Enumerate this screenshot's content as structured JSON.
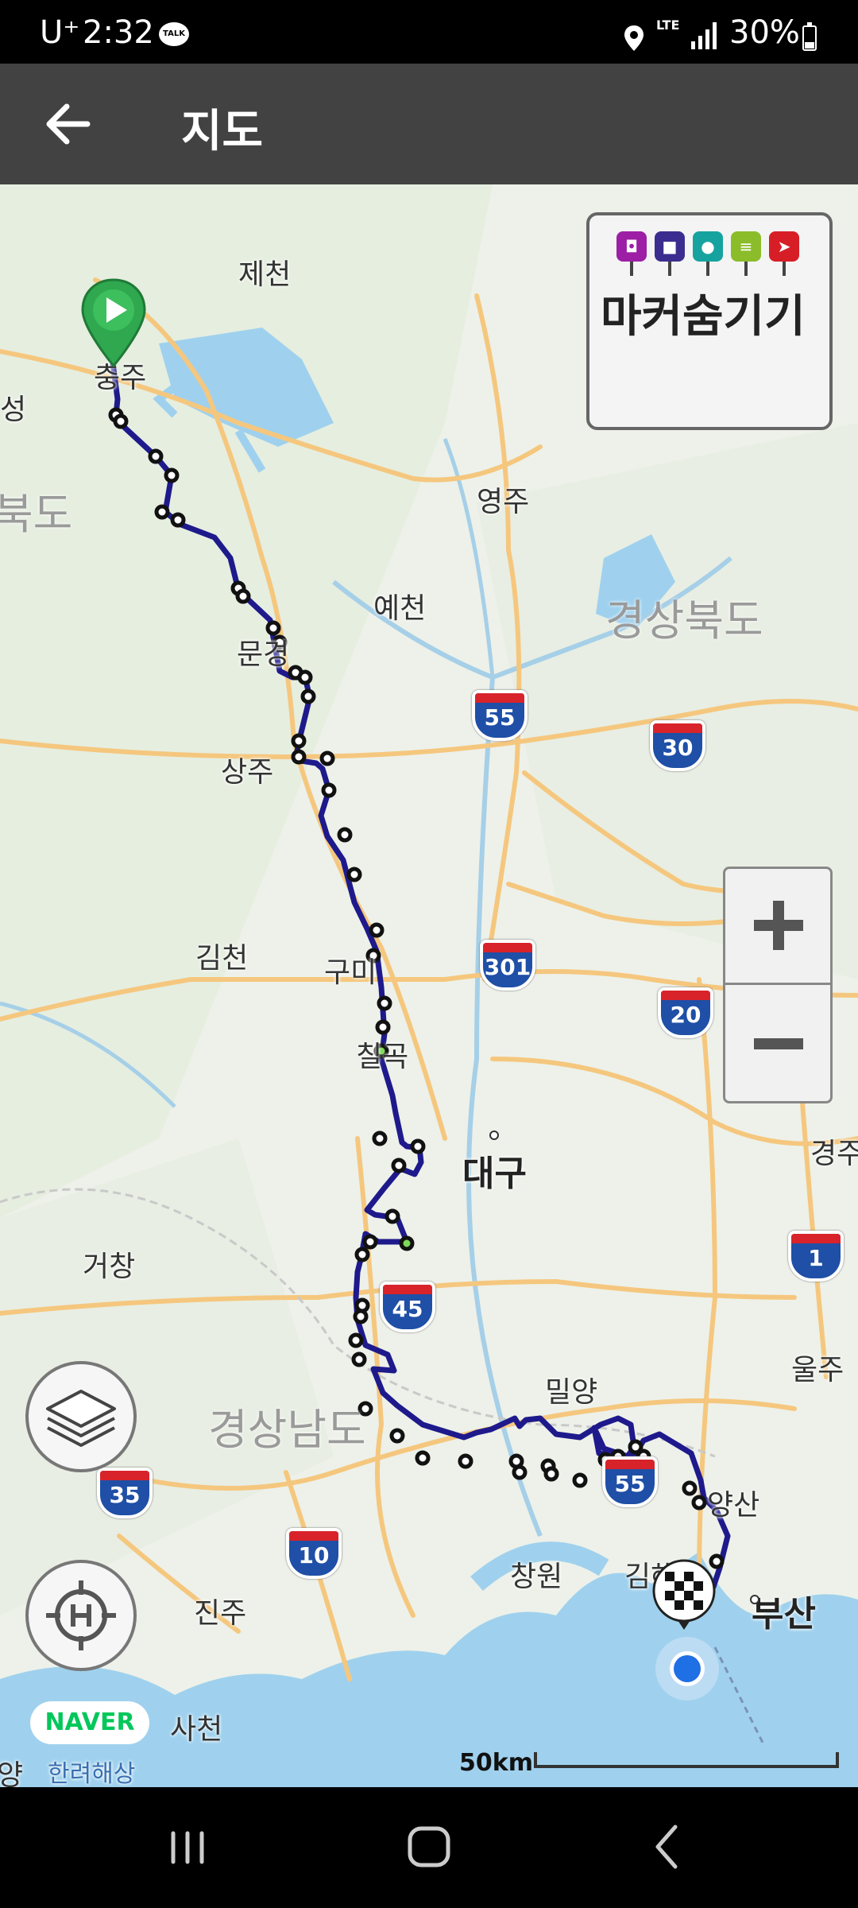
{
  "status_bar": {
    "carrier": "U⁺",
    "time": "2:32",
    "talk_badge": "TALK",
    "network": "LTE",
    "battery": "30%"
  },
  "app_bar": {
    "title": "지도"
  },
  "marker_panel": {
    "label": "마커숨기기",
    "marker_types": [
      {
        "icon": "camera-icon",
        "color": "#9c1fa5"
      },
      {
        "icon": "video-icon",
        "color": "#3b2d8f"
      },
      {
        "icon": "microphone-icon",
        "color": "#16a3a0"
      },
      {
        "icon": "memo-icon",
        "color": "#8bbd2a"
      },
      {
        "icon": "pointer-icon",
        "color": "#d71e26"
      }
    ]
  },
  "map": {
    "provider": "NAVER",
    "scale_label": "50km",
    "cities": [
      "제천",
      "충주",
      "성",
      "영주",
      "예천",
      "문경",
      "상주",
      "김천",
      "구미",
      "칠곡",
      "대구",
      "경주",
      "거창",
      "밀양",
      "울주",
      "양산",
      "창원",
      "김해",
      "부산",
      "진주",
      "사천",
      "양",
      "한려해상"
    ],
    "provinces": [
      "북도",
      "경상북도",
      "경상남도"
    ],
    "highways": [
      "55",
      "30",
      "301",
      "20",
      "45",
      "1",
      "35",
      "10",
      "55"
    ],
    "route_color": "#1e1a8c",
    "start_marker": "play-icon",
    "end_marker": "checkered-flag-icon"
  },
  "controls": {
    "zoom_in": "plus-icon",
    "zoom_out": "minus-icon",
    "layers": "layers-icon",
    "home": "home-target-icon"
  }
}
